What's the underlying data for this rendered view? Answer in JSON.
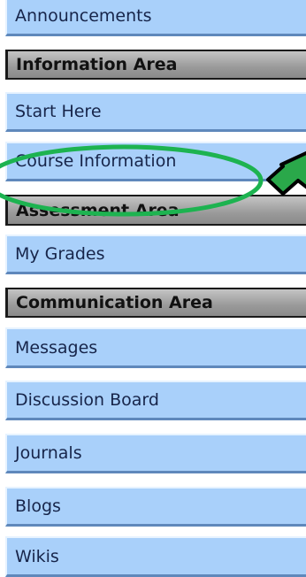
{
  "menu": {
    "items": [
      {
        "type": "link",
        "label": "Announcements"
      },
      {
        "type": "header",
        "label": "Information Area"
      },
      {
        "type": "link",
        "label": "Start Here"
      },
      {
        "type": "link",
        "label": "Course Information"
      },
      {
        "type": "header",
        "label": "Assessment Area"
      },
      {
        "type": "link",
        "label": "My Grades"
      },
      {
        "type": "header",
        "label": "Communication Area"
      },
      {
        "type": "link",
        "label": "Messages"
      },
      {
        "type": "link",
        "label": "Discussion Board"
      },
      {
        "type": "link",
        "label": "Journals"
      },
      {
        "type": "link",
        "label": "Blogs"
      },
      {
        "type": "link",
        "label": "Wikis"
      }
    ]
  },
  "annotation": {
    "ellipse_color": "#1db350",
    "arrow_fill": "#2aa84a",
    "arrow_stroke": "#000000"
  },
  "colors": {
    "link_bg": "#a9d0fa",
    "header_bg": "#9a9a9a",
    "text": "#17254a"
  }
}
